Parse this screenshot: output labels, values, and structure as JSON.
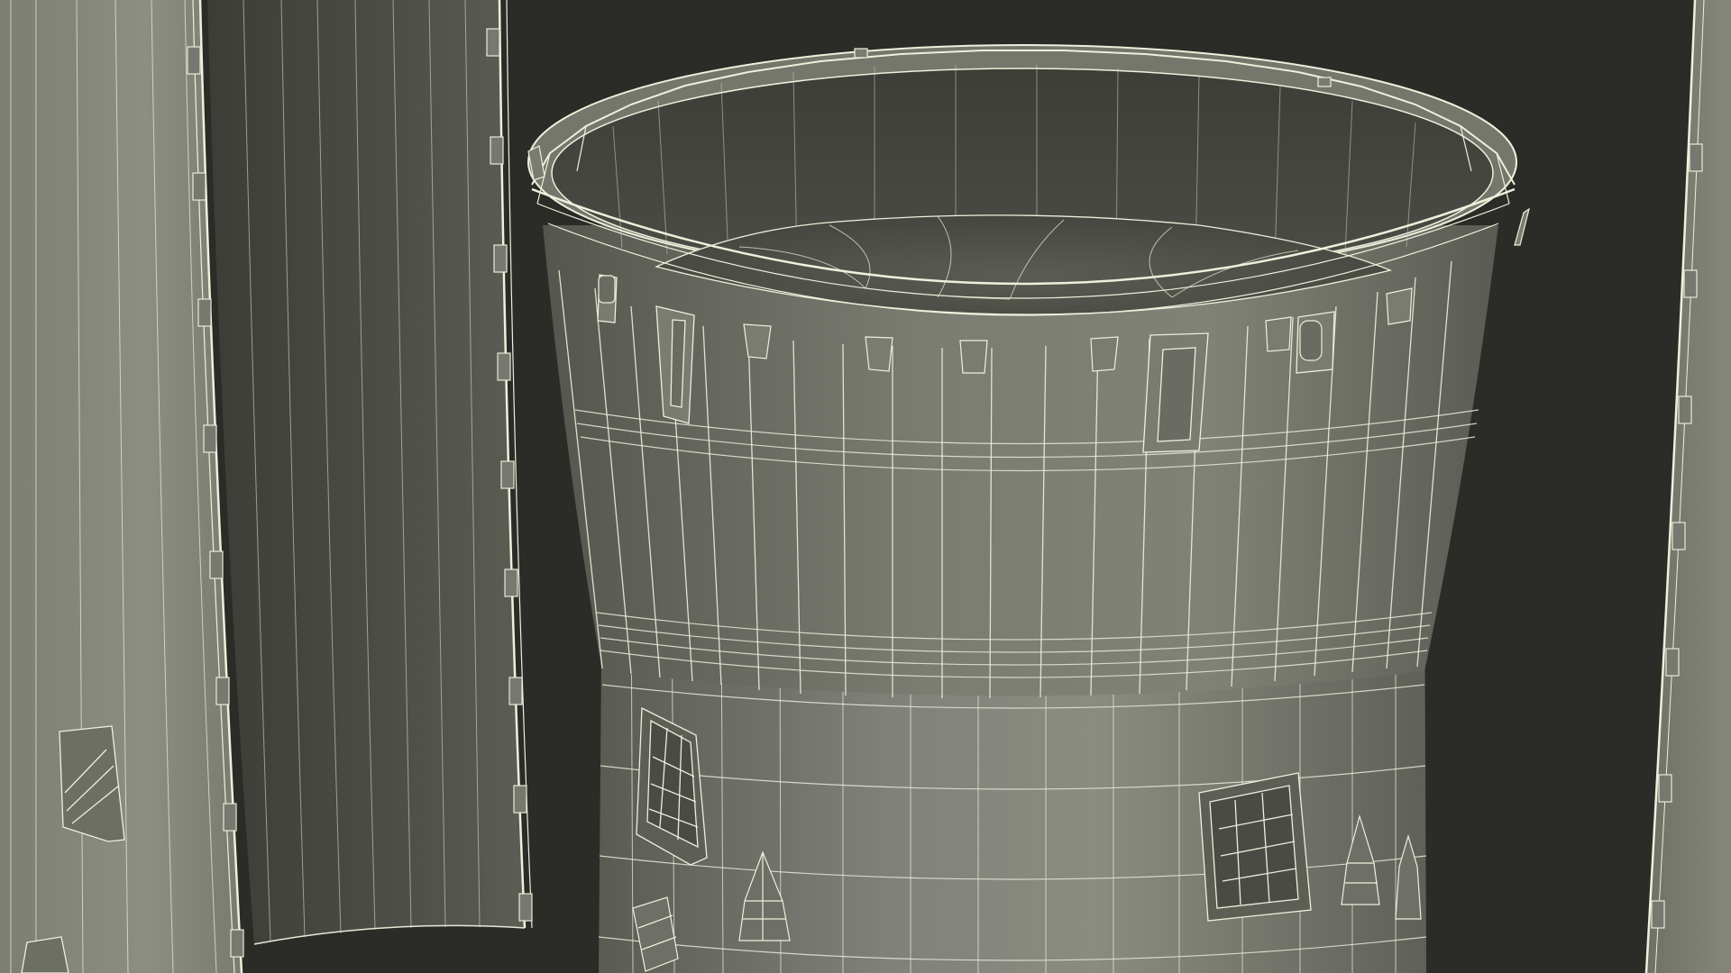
{
  "scene": {
    "subject": "wireframe-render",
    "colors": {
      "background": "#2b2c27",
      "surface_light": "#8a8b80",
      "surface_mid": "#707166",
      "surface_dark": "#3f403a",
      "interior": "#55564e",
      "wire": "#e9ead8"
    }
  }
}
